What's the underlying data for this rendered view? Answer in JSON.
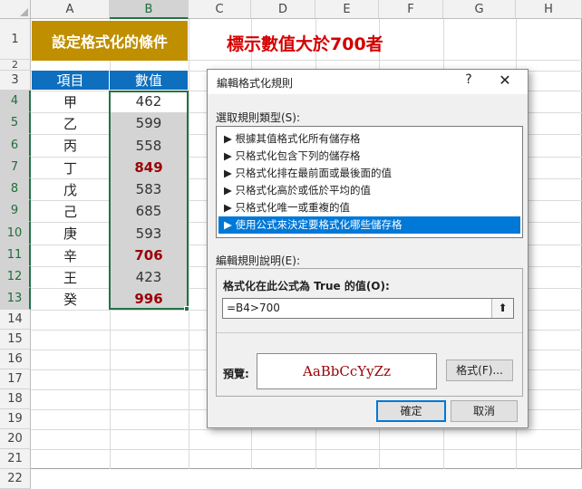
{
  "sheet": {
    "columns": [
      "A",
      "B",
      "C",
      "D",
      "E",
      "F",
      "G",
      "H"
    ],
    "rows": [
      "1",
      "2",
      "3",
      "4",
      "5",
      "6",
      "7",
      "8",
      "9",
      "10",
      "11",
      "12",
      "13",
      "14",
      "15",
      "16",
      "17",
      "18",
      "19",
      "20",
      "21",
      "22"
    ],
    "title": "設定格式化的條件",
    "headline": "標示數值大於700者",
    "table_header": {
      "item": "項目",
      "value": "數值"
    },
    "table_rows": [
      {
        "item": "甲",
        "value": "462"
      },
      {
        "item": "乙",
        "value": "599"
      },
      {
        "item": "丙",
        "value": "558"
      },
      {
        "item": "丁",
        "value": "849"
      },
      {
        "item": "戊",
        "value": "583"
      },
      {
        "item": "己",
        "value": "685"
      },
      {
        "item": "庚",
        "value": "593"
      },
      {
        "item": "辛",
        "value": "706"
      },
      {
        "item": "王",
        "value": "423"
      },
      {
        "item": "癸",
        "value": "996"
      }
    ],
    "colors": {
      "title_bg": "#bf8f00",
      "header_bg": "#0e6fbf",
      "headline": "#d40000",
      "highlight_text": "#9c0006",
      "selection": "#217346"
    }
  },
  "dialog": {
    "title": "編輯格式化規則",
    "help_label": "?",
    "close_label": "✕",
    "rule_type_label": "選取規則類型(S):",
    "rule_types": [
      "▶ 根據其值格式化所有儲存格",
      "▶ 只格式化包含下列的儲存格",
      "▶ 只格式化排在最前面或最後面的值",
      "▶ 只格式化高於或低於平均的值",
      "▶ 只格式化唯一或重複的值",
      "▶ 使用公式來決定要格式化哪些儲存格"
    ],
    "selected_rule_index": 5,
    "description_label": "編輯規則說明(E):",
    "formula_label": "格式化在此公式為 True 的值(O):",
    "formula_value": "=B4>700",
    "collapse_icon": "collapse-arrow-icon",
    "collapse_glyph": "⬆",
    "preview_label": "預覽:",
    "preview_text": "AaBbCcYyZz",
    "format_button": "格式(F)...",
    "ok_button": "確定",
    "cancel_button": "取消"
  }
}
